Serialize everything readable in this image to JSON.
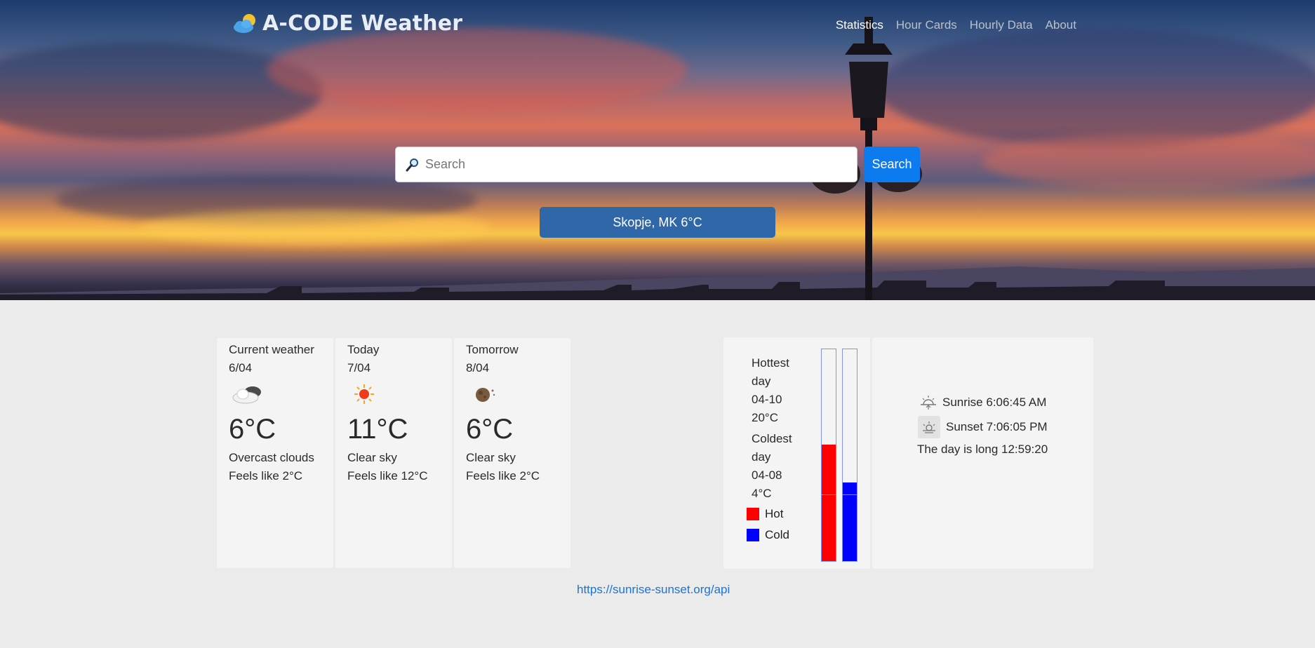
{
  "header": {
    "brand_title": "A-CODE Weather",
    "nav": [
      {
        "label": "Statistics",
        "active": true
      },
      {
        "label": "Hour Cards",
        "active": false
      },
      {
        "label": "Hourly Data",
        "active": false
      },
      {
        "label": "About",
        "active": false
      }
    ]
  },
  "search": {
    "placeholder": "Search",
    "value": "",
    "button_label": "Search"
  },
  "location_button": "Skopje, MK 6°C",
  "cards": [
    {
      "title": "Current weather",
      "date": "6/04",
      "icon": "overcast-clouds-icon",
      "temp": "6°C",
      "description": "Overcast clouds",
      "feels_like": "Feels like 2°C"
    },
    {
      "title": "Today",
      "date": "7/04",
      "icon": "sun-icon",
      "temp": "11°C",
      "description": "Clear sky",
      "feels_like": "Feels like 12°C"
    },
    {
      "title": "Tomorrow",
      "date": "8/04",
      "icon": "moon-icon",
      "temp": "6°C",
      "description": "Clear sky",
      "feels_like": "Feels like 2°C"
    }
  ],
  "stats": {
    "hottest_label": "Hottest day",
    "hottest_date": "04-10",
    "hottest_temp": "20°C",
    "coldest_label": "Coldest day",
    "coldest_date": "04-08",
    "coldest_temp": "4°C",
    "legend": [
      {
        "label": "Hot",
        "color": "#ff0000"
      },
      {
        "label": "Cold",
        "color": "#0000ff"
      }
    ],
    "hot_level": 0.55,
    "cold_level": 0.37,
    "bar_border_color": "#7f93f0"
  },
  "sun": {
    "sunrise": "Sunrise 6:06:45 AM",
    "sunset": "Sunset 7:06:05 PM",
    "day_length": "The day is long 12:59:20"
  },
  "footer_link": "https://sunrise-sunset.org/api"
}
